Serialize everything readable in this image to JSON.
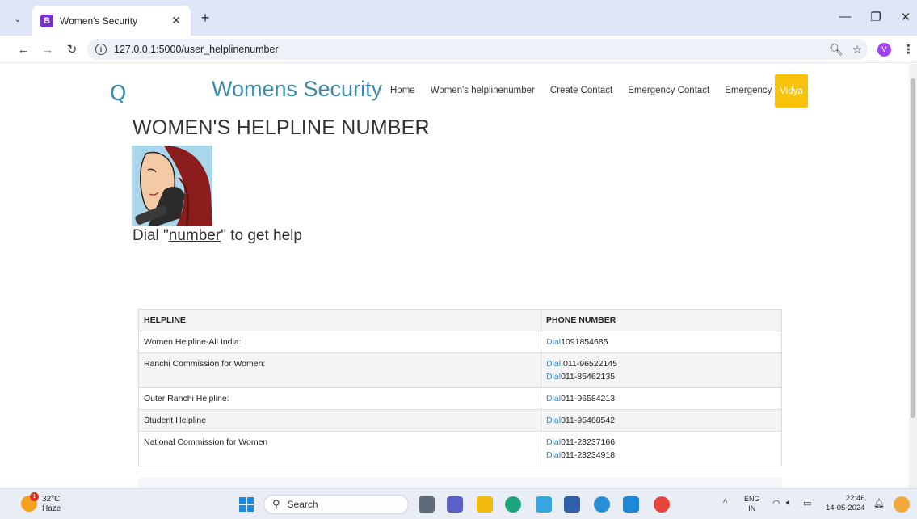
{
  "browser": {
    "tab_menu_glyph": "⌄",
    "tab_favicon_letter": "B",
    "tab_title": "Women's Security",
    "url": "127.0.0.1:5000/user_helplinenumber",
    "profile_letter": "V"
  },
  "site": {
    "logo_letter": "Q",
    "brand": "Womens Security",
    "nav": [
      "Home",
      "Women's helplinenumber",
      "Create Contact",
      "Emergency Contact",
      "Emergency"
    ],
    "user_button": "Vidya"
  },
  "content": {
    "heading": "WOMEN'S HELPLINE NUMBER",
    "dial_prefix": "Dial \"",
    "dial_link": "number",
    "dial_suffix": "\" to get help"
  },
  "table": {
    "headers": [
      "HELPLINE",
      "PHONE NUMBER"
    ],
    "rows": [
      {
        "name": "Women Helpline-All India:",
        "lines": [
          {
            "dial": "Dial",
            "number": "1091854685"
          }
        ]
      },
      {
        "name": "Ranchi Commission for Women:",
        "lines": [
          {
            "dial": "Dial",
            "number": " 011-96522145"
          },
          {
            "dial": "Dial",
            "number": "011-85462135"
          }
        ]
      },
      {
        "name": "Outer Ranchi Helpline:",
        "lines": [
          {
            "dial": "Dial",
            "number": "011-96584213"
          }
        ]
      },
      {
        "name": "Student Helpline",
        "lines": [
          {
            "dial": "Dial",
            "number": "011-95468542"
          }
        ]
      },
      {
        "name": "National Commission for Women",
        "lines": [
          {
            "dial": "Dial",
            "number": "011-23237166"
          },
          {
            "dial": "Dial",
            "number": "011-23234918"
          }
        ]
      }
    ]
  },
  "taskbar": {
    "weather_badge": "1",
    "temperature": "32°C",
    "weather": "Haze",
    "search_placeholder": "Search",
    "lang_top": "ENG",
    "lang_bottom": "IN",
    "time": "22:46",
    "date": "14-05-2024"
  },
  "colors": {
    "brand": "#3c8aa8",
    "user_button": "#f8c20a",
    "dial_link": "#3d8ab2"
  }
}
